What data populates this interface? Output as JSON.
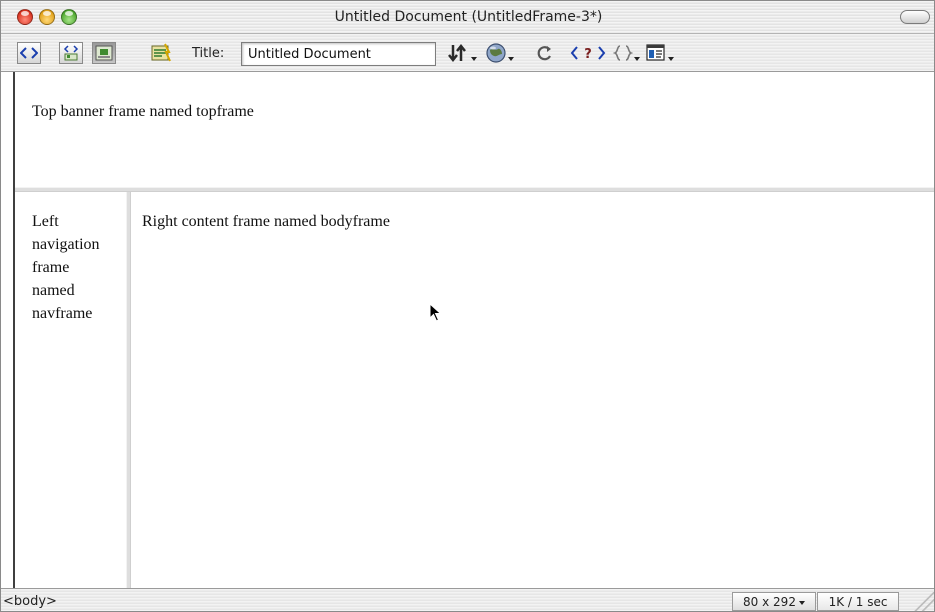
{
  "window": {
    "title": "Untitled Document (UntitledFrame-3*)"
  },
  "toolbar": {
    "title_label": "Title:",
    "title_value": "Untitled Document",
    "buttons": [
      "code-view-icon",
      "split-view-icon",
      "design-view-icon",
      "live-data-icon",
      "file-management-icon",
      "preview-in-browser-icon",
      "refresh-icon",
      "reference-icon",
      "code-navigation-icon",
      "view-options-icon"
    ]
  },
  "frames": {
    "top": "Top banner frame named topframe",
    "left_lines": [
      "Left",
      "navigation",
      "frame",
      "named",
      "navframe"
    ],
    "body": "Right content frame named bodyframe"
  },
  "status": {
    "tag": "<body>",
    "window_size": "80 x 292",
    "download": "1K / 1 sec"
  }
}
